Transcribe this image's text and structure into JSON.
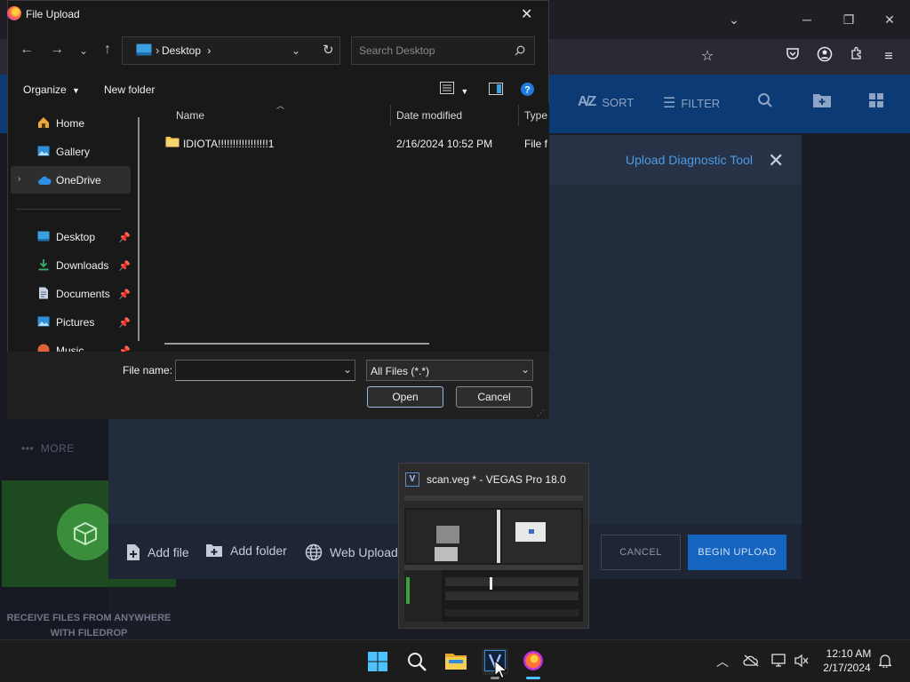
{
  "dialog": {
    "title": "File Upload",
    "address_path": "Desktop",
    "address_sep": "›",
    "search_placeholder": "Search Desktop",
    "organize_label": "Organize",
    "new_folder_label": "New folder",
    "nav": {
      "items": [
        {
          "label": "Home"
        },
        {
          "label": "Gallery"
        },
        {
          "label": "OneDrive"
        },
        {
          "label": "Desktop"
        },
        {
          "label": "Downloads"
        },
        {
          "label": "Documents"
        },
        {
          "label": "Pictures"
        },
        {
          "label": "Music"
        }
      ]
    },
    "columns": {
      "name": "Name",
      "date": "Date modified",
      "type": "Type"
    },
    "files": [
      {
        "name": "IDIOTA!!!!!!!!!!!!!!!!!1",
        "date": "2/16/2024 10:52 PM",
        "type": "File fo"
      }
    ],
    "file_name_label": "File name:",
    "file_name_value": "",
    "file_type_value": "All Files (*.*)",
    "open_label": "Open",
    "cancel_label": "Cancel"
  },
  "app": {
    "toolbar": {
      "sort_label": "SORT",
      "filter_label": "FILTER"
    },
    "upload_panel_title": "Upload Diagnostic Tool",
    "more_label": "MORE",
    "filedrop_caption_1": "RECEIVE FILES FROM ANYWHERE",
    "filedrop_caption_2": "WITH FILEDROP",
    "footer": {
      "add_file": "Add file",
      "add_folder": "Add folder",
      "web_upload": "Web Upload",
      "cancel": "CANCEL",
      "begin_upload": "BEGIN UPLOAD"
    },
    "accent": "#1565c0"
  },
  "preview": {
    "title": "scan.veg * - VEGAS Pro 18.0",
    "icon_text": "V"
  },
  "taskbar": {
    "time": "12:10 AM",
    "date": "2/17/2024",
    "icons": [
      "windows-start-icon",
      "search-icon",
      "file-explorer-icon",
      "vegas-pro-icon",
      "firefox-icon"
    ]
  }
}
